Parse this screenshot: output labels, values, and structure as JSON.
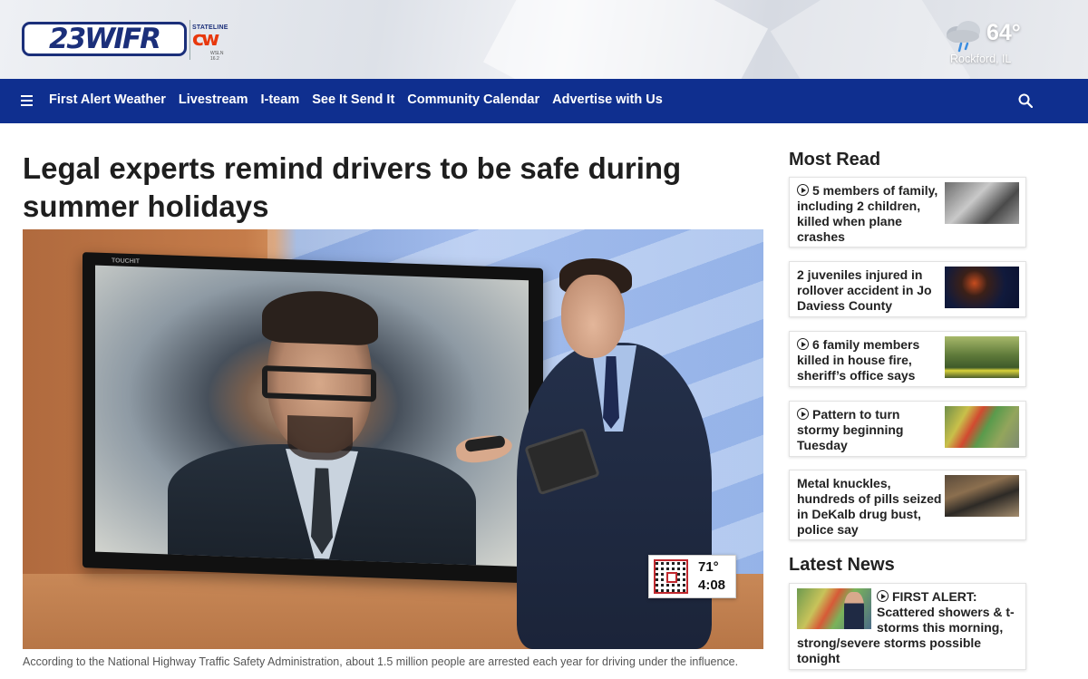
{
  "header": {
    "logo_text": "23WIFR",
    "partner_logo": {
      "top_text": "STATELINE",
      "mark": "cw",
      "bottom_text": "WSLN 16.2"
    },
    "weather": {
      "icon": "rain-cloud-icon",
      "temperature": "64°",
      "city": "Rockford, IL"
    }
  },
  "nav": {
    "menu_icon": "hamburger-icon",
    "items": [
      {
        "label": "First Alert Weather"
      },
      {
        "label": "Livestream"
      },
      {
        "label": "I-team"
      },
      {
        "label": "See It Send It"
      },
      {
        "label": "Community Calendar"
      },
      {
        "label": "Advertise with Us"
      }
    ],
    "search_icon": "search-icon"
  },
  "article": {
    "headline": "Legal experts remind drivers to be safe during summer holidays",
    "image": {
      "tv_brand": "TOUCHIT",
      "bug_temperature": "71°",
      "bug_time": "4:08"
    },
    "caption": "According to the National Highway Traffic Safety Administration, about 1.5 million people are arrested each year for driving under the influence."
  },
  "most_read": {
    "title": "Most Read",
    "items": [
      {
        "text": "5 members of family, including 2 children, killed when plane crashes",
        "video": true
      },
      {
        "text": "2 juveniles injured in rollover accident in Jo Daviess County",
        "video": false
      },
      {
        "text": "6 family members killed in house fire, sheriff’s office says",
        "video": true
      },
      {
        "text": "Pattern to turn stormy beginning Tuesday",
        "video": true
      },
      {
        "text": "Metal knuckles, hundreds of pills seized in DeKalb drug bust, police say",
        "video": false
      }
    ]
  },
  "latest_news": {
    "title": "Latest News",
    "items": [
      {
        "text_top": "FIRST ALERT: Scattered showers & t-storms this morning,",
        "text_bottom": "strong/severe storms possible tonight",
        "video": true
      }
    ]
  },
  "colors": {
    "nav_bg": "#0f2f8f",
    "brand_blue": "#1b2f7a",
    "cw_red": "#e8380d"
  }
}
